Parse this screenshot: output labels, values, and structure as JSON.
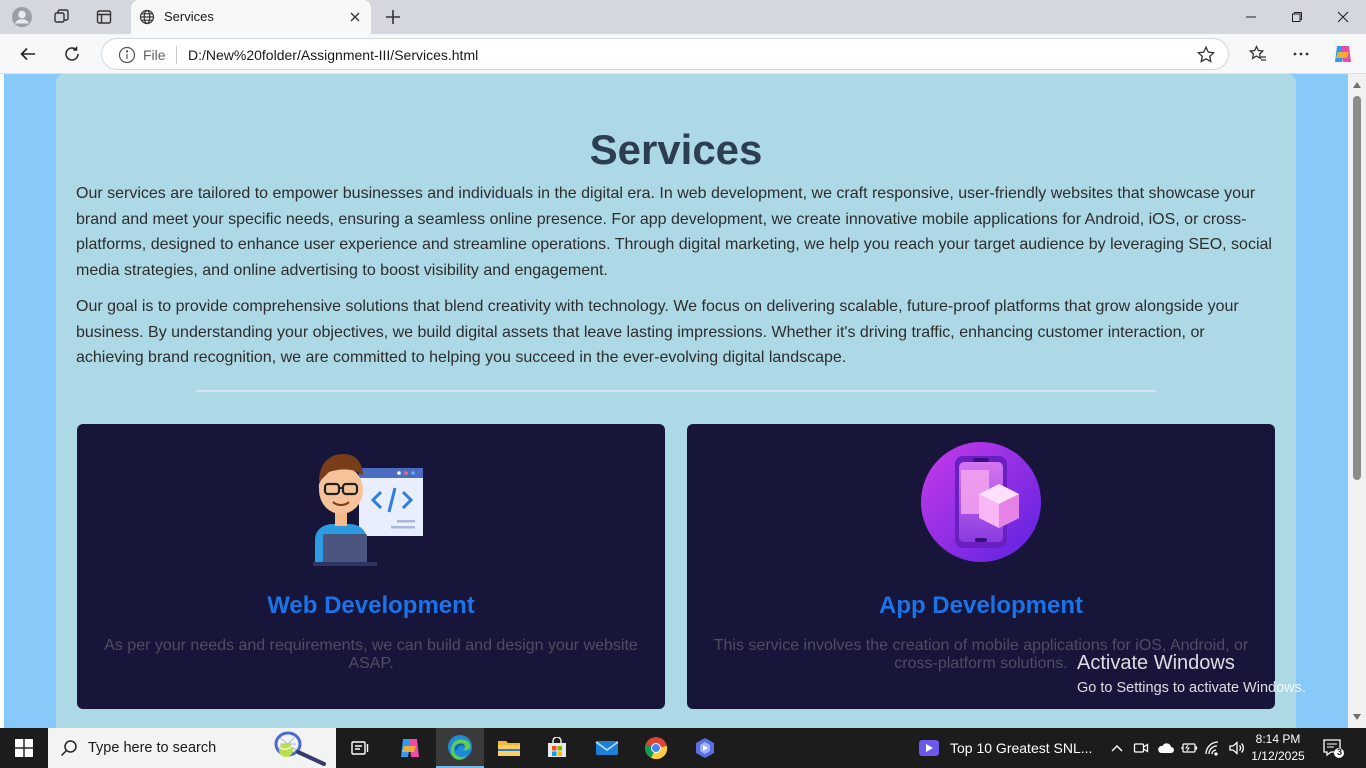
{
  "browser": {
    "tab_title": "Services",
    "address_scheme": "File",
    "url": "D:/New%20folder/Assignment-III/Services.html"
  },
  "page": {
    "heading": "Services",
    "paragraphs": [
      "Our services are tailored to empower businesses and individuals in the digital era. In web development, we craft responsive, user-friendly websites that showcase your brand and meet your specific needs, ensuring a seamless online presence. For app development, we create innovative mobile applications for Android, iOS, or cross-platforms, designed to enhance user experience and streamline operations. Through digital marketing, we help you reach your target audience by leveraging SEO, social media strategies, and online advertising to boost visibility and engagement.",
      "Our goal is to provide comprehensive solutions that blend creativity with technology. We focus on delivering scalable, future-proof platforms that grow alongside your business. By understanding your objectives, we build digital assets that leave lasting impressions. Whether it's driving traffic, enhancing customer interaction, or achieving brand recognition, we are committed to helping you succeed in the ever-evolving digital landscape."
    ],
    "cards": [
      {
        "title": "Web Development",
        "description": "As per your needs and requirements, we can build and design your website ASAP.",
        "icon": "developer-illustration-icon"
      },
      {
        "title": "App Development",
        "description": "This service involves the creation of mobile applications for iOS, Android, or cross-platform solutions.",
        "icon": "mobile-app-illustration-icon"
      }
    ]
  },
  "watermark": {
    "title": "Activate Windows",
    "subtitle": "Go to Settings to activate Windows."
  },
  "taskbar": {
    "search_placeholder": "Type here to search",
    "news_text": "Top 10 Greatest SNL...",
    "time": "8:14 PM",
    "date": "1/12/2025",
    "notification_count": "3"
  },
  "colors": {
    "page_background": "#87c9f8",
    "container_background": "#add8e6",
    "heading": "#2c3e50",
    "card_background": "#18153a",
    "card_title": "#1a73e8"
  }
}
